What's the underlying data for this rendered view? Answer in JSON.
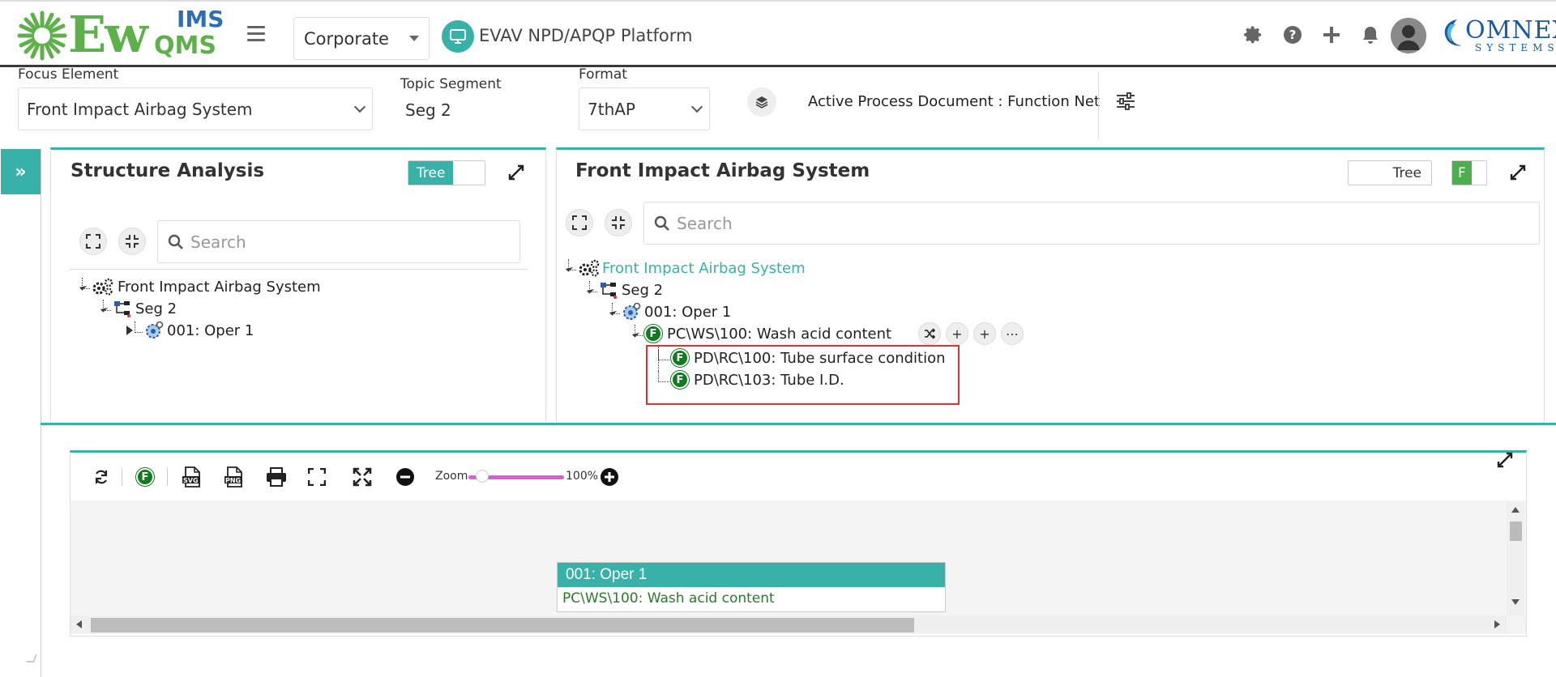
{
  "header": {
    "logo": {
      "ew": "Ew",
      "ims": "IMS",
      "qms": "QMS"
    },
    "corporate": "Corporate",
    "platform_title": "EVAV NPD/APQP Platform",
    "omnex": {
      "name": "OMNEX",
      "sub": "SYSTEMS"
    },
    "icons": [
      "gear-icon",
      "help-icon",
      "plus-icon",
      "bell-icon",
      "user-avatar"
    ]
  },
  "filters": {
    "focus_element": {
      "label": "Focus Element",
      "value": "Front Impact Airbag System"
    },
    "topic_segment": {
      "label": "Topic Segment",
      "value": "Seg 2"
    },
    "format": {
      "label": "Format",
      "value": "7thAP"
    },
    "active_doc": "Active Process Document : Function Net"
  },
  "structure_panel": {
    "title": "Structure Analysis",
    "toggle_label": "Tree",
    "search_placeholder": "Search",
    "tree": [
      {
        "label": "Front Impact Airbag System"
      },
      {
        "label": "Seg 2"
      },
      {
        "label": "001: Oper 1"
      }
    ]
  },
  "function_panel": {
    "title": "Front Impact Airbag System",
    "toggle_label": "Tree",
    "f_toggle": "F",
    "search_placeholder": "Search",
    "tree": [
      {
        "label": "Front Impact Airbag System"
      },
      {
        "label": "Seg 2"
      },
      {
        "label": "001: Oper 1"
      },
      {
        "label": "PC\\WS\\100: Wash acid content",
        "badge": "F"
      },
      {
        "label": "PD\\RC\\100: Tube surface condition",
        "badge": "F"
      },
      {
        "label": "PD\\RC\\103: Tube I.D.",
        "badge": "F"
      }
    ]
  },
  "canvas": {
    "toolbar": {
      "f_badge": "F",
      "svg_label": "SVG",
      "png_label": "PNG",
      "zoom_label": "Zoom",
      "zoom_value": "100%",
      "zoom_level": 0.14
    },
    "node": {
      "header": "001: Oper 1",
      "body": "PC\\WS\\100: Wash acid content"
    }
  },
  "colors": {
    "accent": "#38b2a8",
    "function_green": "#127a1f",
    "highlight": "#d33333",
    "zoom_track": "#e05ad8"
  }
}
